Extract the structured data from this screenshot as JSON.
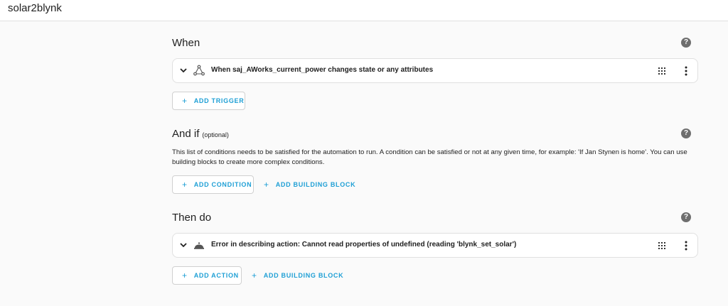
{
  "app": {
    "title": "solar2blynk"
  },
  "when": {
    "title": "When",
    "trigger_text": "When saj_AWorks_current_power changes state or any attributes",
    "add_trigger_label": "ADD TRIGGER"
  },
  "and_if": {
    "title": "And if",
    "optional_label": "(optional)",
    "description": "This list of conditions needs to be satisfied for the automation to run. A condition can be satisfied or not at any given time, for example: 'If Jan Stynen is home'. You can use building blocks to create more complex conditions.",
    "add_condition_label": "ADD CONDITION",
    "add_building_block_label": "ADD BUILDING BLOCK"
  },
  "then_do": {
    "title": "Then do",
    "action_text": "Error in describing action: Cannot read properties of undefined (reading 'blynk_set_solar')",
    "add_action_label": "ADD ACTION",
    "add_building_block_label": "ADD BUILDING BLOCK"
  },
  "icons": {
    "help": "?",
    "plus": "+"
  },
  "colors": {
    "accent": "#1e9fd5",
    "background": "#fafafa",
    "card": "#ffffff",
    "help_icon": "#6e6e6e"
  }
}
